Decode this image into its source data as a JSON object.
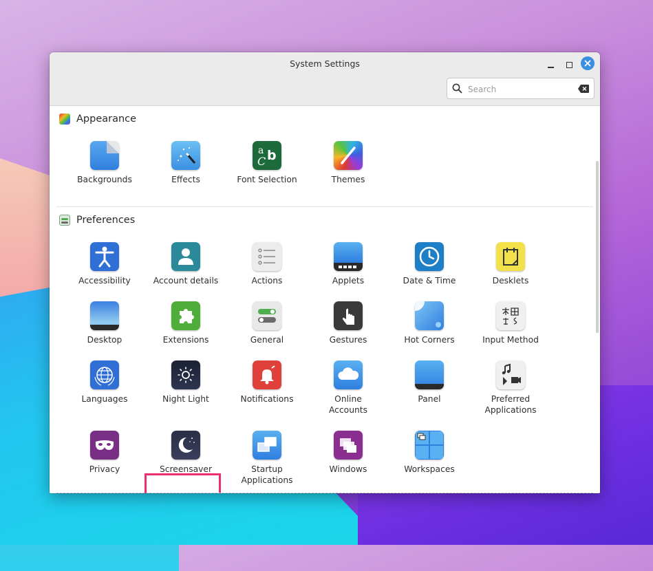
{
  "window": {
    "title": "System Settings"
  },
  "search": {
    "placeholder": "Search"
  },
  "sections": {
    "appearance": {
      "label": "Appearance",
      "items": [
        "Backgrounds",
        "Effects",
        "Font Selection",
        "Themes"
      ]
    },
    "preferences": {
      "label": "Preferences",
      "items": [
        "Accessibility",
        "Account details",
        "Actions",
        "Applets",
        "Date & Time",
        "Desklets",
        "Desktop",
        "Extensions",
        "General",
        "Gestures",
        "Hot Corners",
        "Input Method",
        "Languages",
        "Night Light",
        "Notifications",
        "Online\nAccounts",
        "Panel",
        "Preferred\nApplications",
        "Privacy",
        "Screensaver",
        "Startup\nApplications",
        "Windows",
        "Workspaces"
      ]
    }
  },
  "highlighted_item": "Screensaver",
  "colors": {
    "highlight": "#ec2f6a",
    "close_button": "#3a8fe0"
  }
}
